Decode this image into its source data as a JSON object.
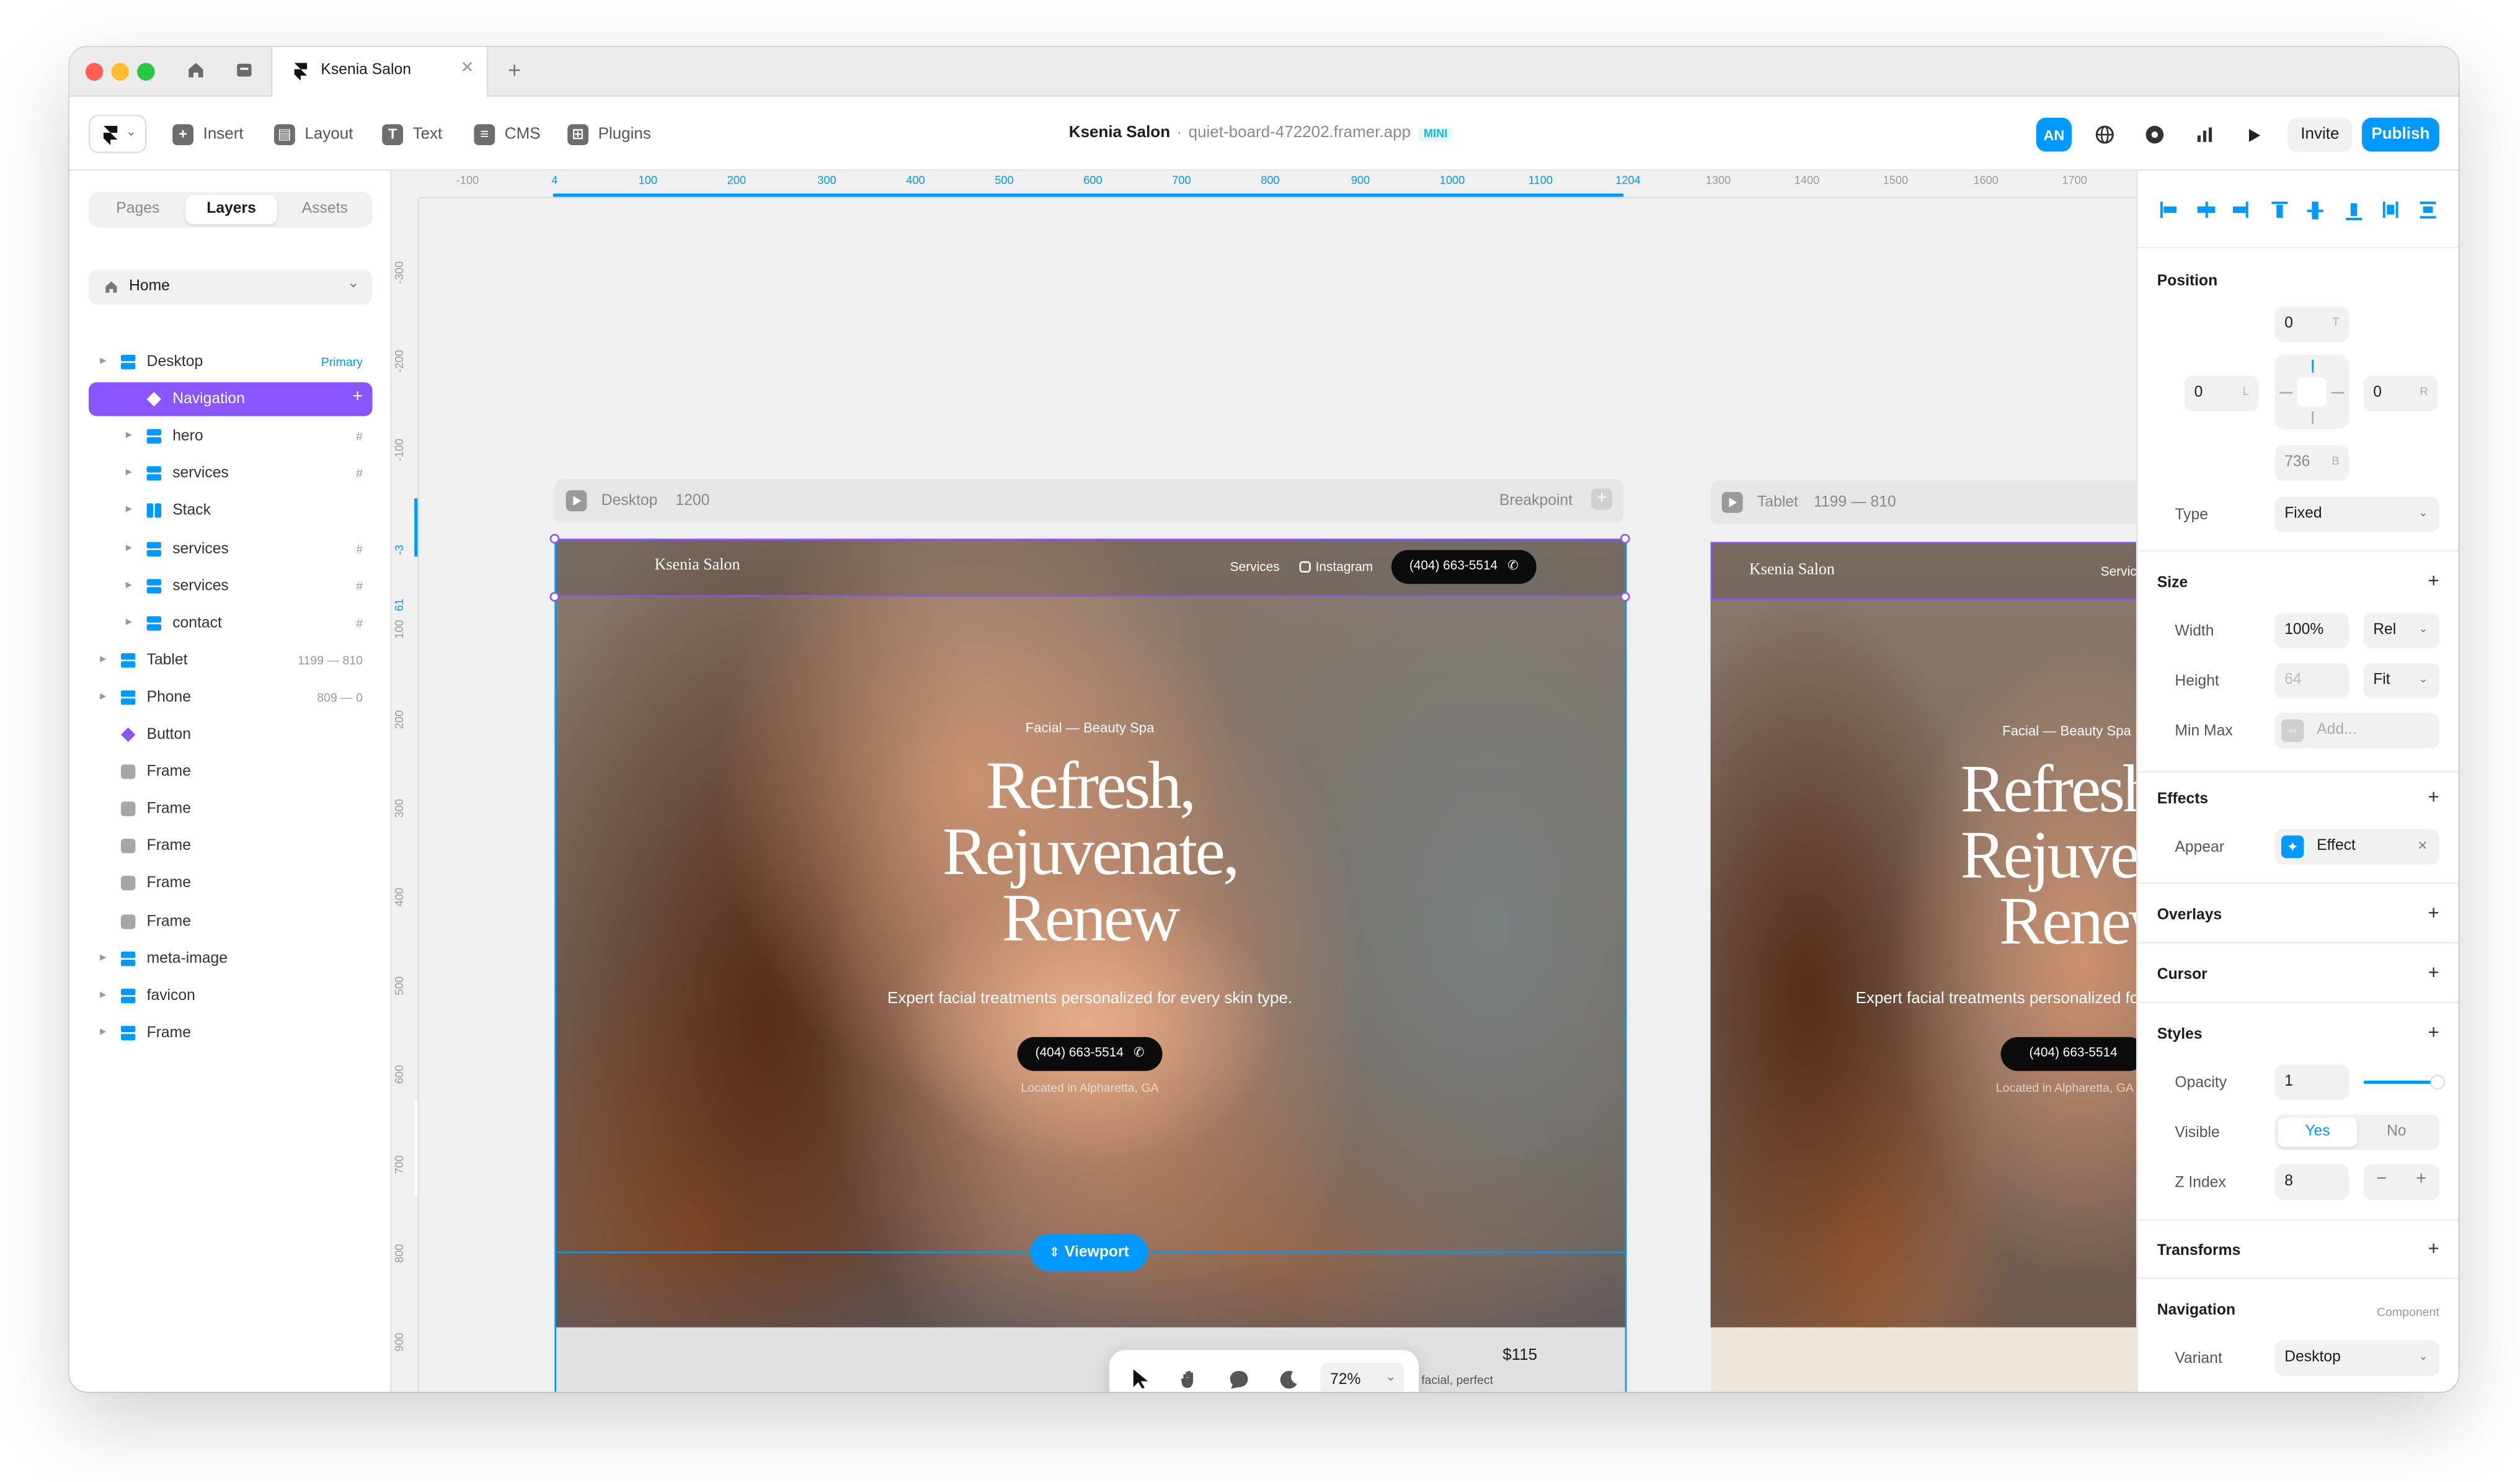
{
  "window": {
    "tab_title": "Ksenia Salon"
  },
  "toolbar": {
    "insert": "Insert",
    "layout": "Layout",
    "text": "Text",
    "cms": "CMS",
    "plugins": "Plugins",
    "site_name": "Ksenia Salon",
    "site_url": "quiet-board-472202.framer.app",
    "plan_badge": "MINI",
    "avatar": "AN",
    "invite": "Invite",
    "publish": "Publish"
  },
  "left_panel": {
    "tabs": [
      "Pages",
      "Layers",
      "Assets"
    ],
    "active_tab": "Layers",
    "page_select": "Home",
    "layers": [
      {
        "name": "Desktop",
        "right": "Primary",
        "icon": "breakpoint-icon"
      },
      {
        "name": "Navigation",
        "right": "+",
        "icon": "component-icon"
      },
      {
        "name": "hero",
        "right": "#",
        "icon": "stack-icon"
      },
      {
        "name": "services",
        "right": "#",
        "icon": "stack-icon"
      },
      {
        "name": "Stack",
        "right": "",
        "icon": "stack-horizontal-icon"
      },
      {
        "name": "services",
        "right": "#",
        "icon": "stack-icon"
      },
      {
        "name": "services",
        "right": "#",
        "icon": "stack-icon"
      },
      {
        "name": "contact",
        "right": "#",
        "icon": "stack-icon"
      },
      {
        "name": "Tablet",
        "right": "1199 — 810",
        "icon": "breakpoint-icon"
      },
      {
        "name": "Phone",
        "right": "809 — 0",
        "icon": "breakpoint-icon"
      },
      {
        "name": "Button",
        "right": "",
        "icon": "component-icon"
      },
      {
        "name": "Frame",
        "right": "",
        "icon": "frame-icon"
      },
      {
        "name": "Frame",
        "right": "",
        "icon": "frame-icon"
      },
      {
        "name": "Frame",
        "right": "",
        "icon": "frame-icon"
      },
      {
        "name": "Frame",
        "right": "",
        "icon": "frame-icon"
      },
      {
        "name": "Frame",
        "right": "",
        "icon": "frame-icon"
      },
      {
        "name": "meta-image",
        "right": "",
        "icon": "breakpoint-icon"
      },
      {
        "name": "favicon",
        "right": "",
        "icon": "breakpoint-icon"
      },
      {
        "name": "Frame",
        "right": "",
        "icon": "breakpoint-icon"
      }
    ]
  },
  "rulers": {
    "top": [
      "-100",
      "4",
      "100",
      "200",
      "300",
      "400",
      "500",
      "600",
      "700",
      "800",
      "900",
      "1000",
      "1100",
      "1204",
      "1300",
      "1400",
      "1500",
      "1600",
      "1700"
    ],
    "left": [
      "-300",
      "-200",
      "-100",
      "-3",
      "61",
      "100",
      "200",
      "300",
      "400",
      "500",
      "600",
      "700",
      "800",
      "900",
      "1000"
    ]
  },
  "canvas": {
    "desktop_frame": {
      "label": "Desktop",
      "width": "1200",
      "breakpoint": "Breakpoint"
    },
    "tablet_frame": {
      "label": "Tablet",
      "range": "1199 — 810"
    },
    "site": {
      "brand": "Ksenia Salon",
      "nav_services": "Services",
      "nav_instagram": "Instagram",
      "phone": "(404) 663-5514",
      "eyebrow": "Facial — Beauty Spa",
      "headline": [
        "Refresh,",
        "Rejuvenate,",
        "Renew"
      ],
      "subhead": "Expert facial treatments personalized for every skin type.",
      "location": "Located in Alpharetta, GA",
      "price": "$115",
      "service_desc": "Relax and unwind with our signature classic facial, perfect"
    },
    "viewport_label": "Viewport",
    "zoom": "72%"
  },
  "right_panel": {
    "position": {
      "title": "Position",
      "top": "0",
      "top_tag": "T",
      "left": "0",
      "left_tag": "L",
      "right": "0",
      "right_tag": "R",
      "bottom": "736",
      "bottom_tag": "B"
    },
    "type": {
      "label": "Type",
      "value": "Fixed"
    },
    "size": {
      "title": "Size",
      "width_label": "Width",
      "width": "100%",
      "width_unit": "Rel",
      "height_label": "Height",
      "height": "64",
      "height_unit": "Fit",
      "minmax_label": "Min Max",
      "minmax": "Add..."
    },
    "effects": {
      "title": "Effects",
      "appear_label": "Appear",
      "appear_value": "Effect"
    },
    "overlays": "Overlays",
    "cursor": "Cursor",
    "styles": {
      "title": "Styles",
      "opacity_label": "Opacity",
      "opacity": "1",
      "visible_label": "Visible",
      "yes": "Yes",
      "no": "No",
      "z_label": "Z Index",
      "z": "8"
    },
    "transforms": "Transforms",
    "navigation": {
      "title": "Navigation",
      "tag": "Component",
      "variant_label": "Variant",
      "variant": "Desktop"
    }
  },
  "colors": {
    "accent": "#0099ff",
    "selection": "#8855ff",
    "dark_pill": "#0b0b0b"
  }
}
